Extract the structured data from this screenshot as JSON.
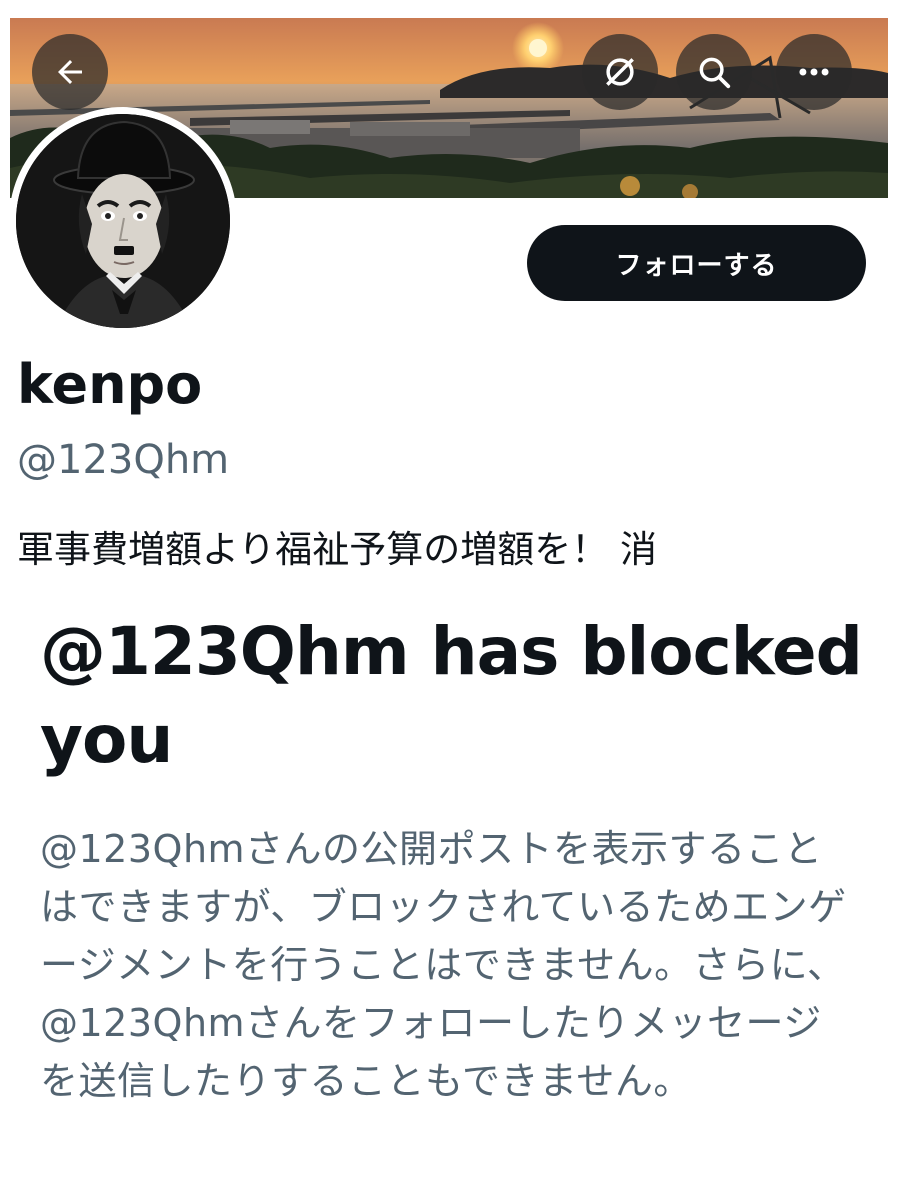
{
  "header": {
    "back_icon": "arrow-left-icon",
    "actions": [
      {
        "icon": "no-notifications-icon"
      },
      {
        "icon": "search-icon"
      },
      {
        "icon": "more-horizontal-icon"
      }
    ]
  },
  "profile": {
    "display_name": "kenpo",
    "handle": "@123Qhm",
    "bio": "軍事費増額より福祉予算の増額を！ 消",
    "follow_label": "フォローする"
  },
  "block_notice": {
    "title": "@123Qhm has blocked you",
    "description": "@123Qhmさんの公開ポストを表示することはできますが、ブロックされているためエンゲージメントを行うことはできません。さらに、@123Qhmさんをフォローしたりメッセージを送信したりすることもできません。"
  },
  "colors": {
    "primary_text": "#0f1419",
    "secondary_text": "#536471",
    "button_bg": "#0f1419",
    "button_text": "#ffffff"
  }
}
